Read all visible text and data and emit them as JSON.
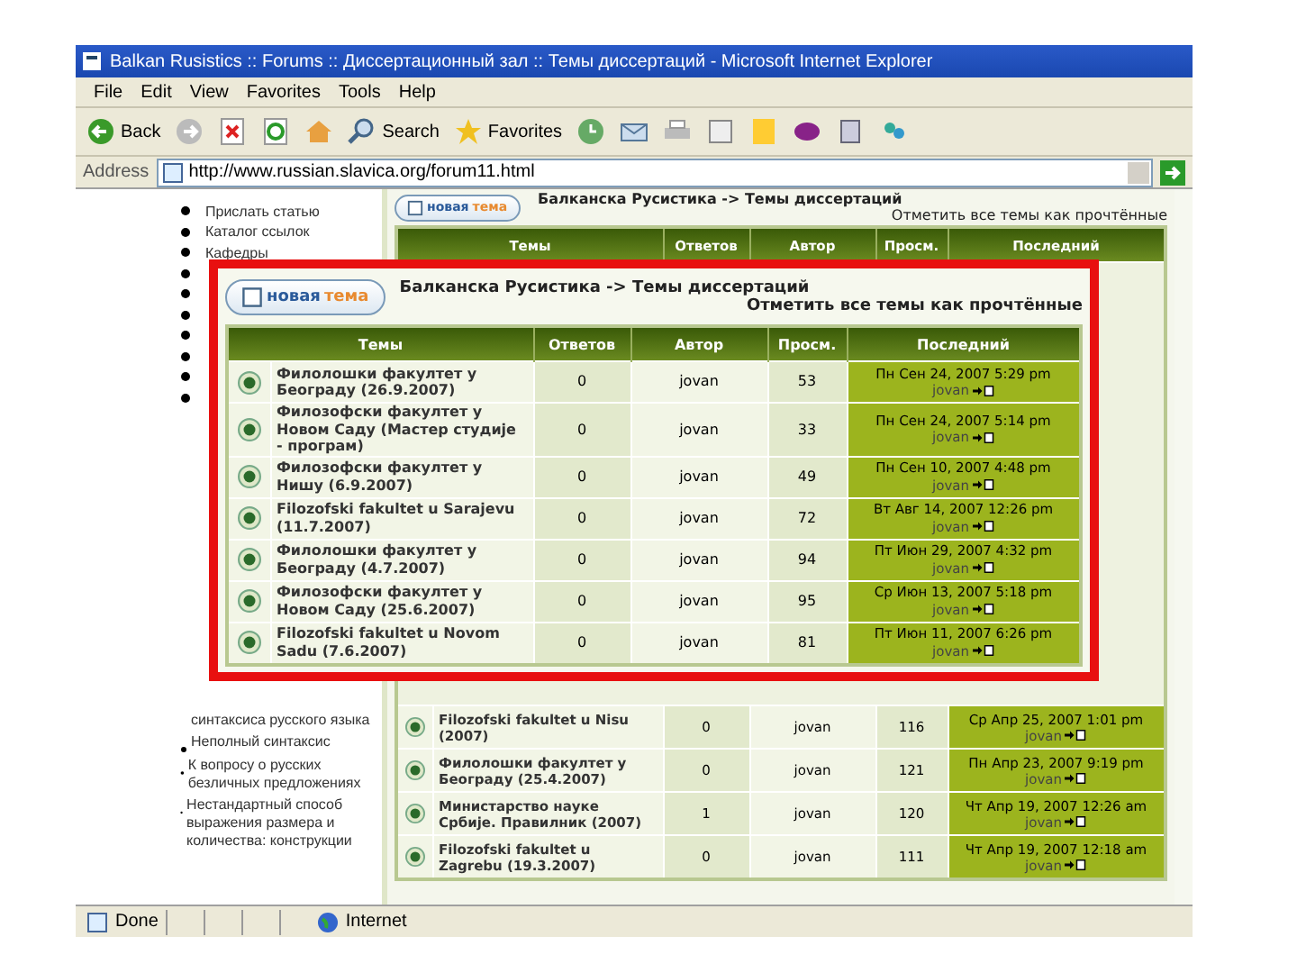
{
  "window": {
    "title": "Balkan Rusistics :: Forums :: Диссертационный зал :: Темы диссертаций - Microsoft Internet Explorer"
  },
  "menu": [
    "File",
    "Edit",
    "View",
    "Favorites",
    "Tools",
    "Help"
  ],
  "toolbar": {
    "back": "Back",
    "search": "Search",
    "favorites": "Favorites"
  },
  "address": {
    "label": "Address",
    "url": "http://www.russian.slavica.org/forum11.html"
  },
  "sidebar": {
    "top_items": [
      {
        "kind": "link",
        "text": "Прислать статью"
      },
      {
        "kind": "link",
        "text": "Каталог ссылок"
      },
      {
        "kind": "link",
        "text": "Кафедры"
      },
      {
        "kind": "bullet"
      },
      {
        "kind": "bullet"
      },
      {
        "kind": "bullet"
      },
      {
        "kind": "bullet"
      },
      {
        "kind": "bullet"
      },
      {
        "kind": "bullet"
      },
      {
        "kind": "bullet"
      }
    ],
    "lower_items": [
      {
        "text": "синтаксиса русского языка",
        "bullet": false
      },
      {
        "text": "Неполный синтаксис",
        "bullet": true
      },
      {
        "text": "К вопросу о русских безличных предложениях",
        "bullet": true
      },
      {
        "text": "Нестандартный способ выражения размера и количества: конструкции",
        "bullet": true
      }
    ]
  },
  "forum": {
    "new_topic": {
      "part1": "новая",
      "part2": "тема"
    },
    "title": "Балканска Русистика -> Темы диссертаций",
    "mark_read": "Отметить все темы как прочтённые",
    "columns": [
      "Темы",
      "Ответов",
      "Автор",
      "Просм.",
      "Последний"
    ],
    "rows": [
      {
        "topic": "Filozofski fakultet u Nisu (2007)",
        "replies": "0",
        "author": "jovan",
        "views": "116",
        "last_date": "Ср Апр 25, 2007 1:01 pm",
        "last_author": "jovan"
      },
      {
        "topic": "Филолошки факултет у Београду (25.4.2007)",
        "replies": "0",
        "author": "jovan",
        "views": "121",
        "last_date": "Пн Апр 23, 2007 9:19 pm",
        "last_author": "jovan"
      },
      {
        "topic": "Министарство науке Србије. Правилник (2007)",
        "replies": "1",
        "author": "jovan",
        "views": "120",
        "last_date": "Чт Апр 19, 2007 12:26 am",
        "last_author": "jovan"
      },
      {
        "topic": "Filozofski fakultet u Zagrebu (19.3.2007)",
        "replies": "0",
        "author": "jovan",
        "views": "111",
        "last_date": "Чт Апр 19, 2007 12:18 am",
        "last_author": "jovan"
      }
    ]
  },
  "zoomed": {
    "new_topic": {
      "part1": "новая",
      "part2": "тема"
    },
    "title": "Балканска Русистика -> Темы диссертаций",
    "mark_read": "Отметить все темы как прочтённые",
    "columns": [
      "Темы",
      "Ответов",
      "Автор",
      "Просм.",
      "Последний"
    ],
    "rows": [
      {
        "topic": "Филолошки факултет у Београду (26.9.2007)",
        "replies": "0",
        "author": "jovan",
        "views": "53",
        "last_date": "Пн Сен 24, 2007 5:29 pm",
        "last_author": "jovan"
      },
      {
        "topic": "Филозофски факултет у Новом Саду (Мастер студије - програм)",
        "replies": "0",
        "author": "jovan",
        "views": "33",
        "last_date": "Пн Сен 24, 2007 5:14 pm",
        "last_author": "jovan"
      },
      {
        "topic": "Филозофски факултет у Нишу (6.9.2007)",
        "replies": "0",
        "author": "jovan",
        "views": "49",
        "last_date": "Пн Сен 10, 2007 4:48 pm",
        "last_author": "jovan"
      },
      {
        "topic": "Filozofski fakultet u Sarajevu (11.7.2007)",
        "replies": "0",
        "author": "jovan",
        "views": "72",
        "last_date": "Вт Авг 14, 2007 12:26 pm",
        "last_author": "jovan"
      },
      {
        "topic": "Филолошки факултет у Београду (4.7.2007)",
        "replies": "0",
        "author": "jovan",
        "views": "94",
        "last_date": "Пт Июн 29, 2007 4:32 pm",
        "last_author": "jovan"
      },
      {
        "topic": "Филозофски факултет у Новом Саду (25.6.2007)",
        "replies": "0",
        "author": "jovan",
        "views": "95",
        "last_date": "Ср Июн 13, 2007 5:18 pm",
        "last_author": "jovan"
      },
      {
        "topic": "Filozofski fakultet u Novom Sadu (7.6.2007)",
        "replies": "0",
        "author": "jovan",
        "views": "81",
        "last_date": "Пт Июн 11, 2007 6:26 pm",
        "last_author": "jovan"
      }
    ]
  },
  "status": {
    "text": "Done",
    "zone": "Internet"
  }
}
